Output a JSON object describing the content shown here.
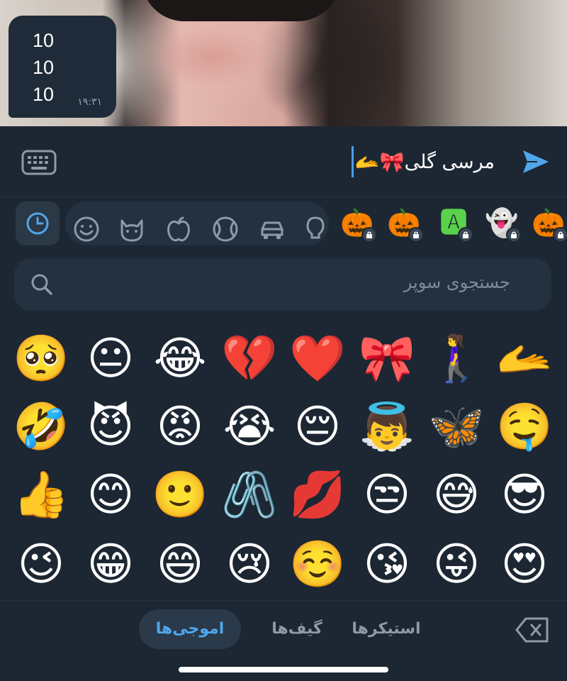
{
  "message": {
    "lines": [
      "10",
      "10",
      "10"
    ],
    "time": "۱۹:۳۱"
  },
  "input": {
    "text": "مرسی گلی",
    "emojis": "🎀🫴"
  },
  "categories": {
    "icons": [
      "recent-clock-icon",
      "smiley-icon",
      "cat-icon",
      "apple-icon",
      "ball-icon",
      "car-icon",
      "lightbulb-icon"
    ],
    "packs": [
      "🎃",
      "🎃",
      "🅰",
      "👻",
      "🎃"
    ]
  },
  "search": {
    "placeholder": "جستجوی سوپر"
  },
  "emoji_grid": [
    [
      "🥺",
      "😐",
      "😂",
      "💔",
      "❤️",
      "🎀",
      "🚶‍♀️",
      "🫴"
    ],
    [
      "🤣",
      "😈",
      "😡",
      "😭",
      "😔",
      "👼",
      "🦋",
      "🤤"
    ],
    [
      "👍",
      "😊",
      "🙂",
      "🖇️",
      "💋",
      "😒",
      "😅",
      "😎"
    ],
    [
      "😉",
      "😁",
      "😄",
      "😢",
      "☺️",
      "😘",
      "😜",
      "😍"
    ]
  ],
  "tabs": {
    "emojis": "اموجی‌ها",
    "gifs": "گیف‌ها",
    "stickers": "استیکرها"
  },
  "colors": {
    "accent": "#4fa7ec",
    "background": "#1c2733"
  }
}
